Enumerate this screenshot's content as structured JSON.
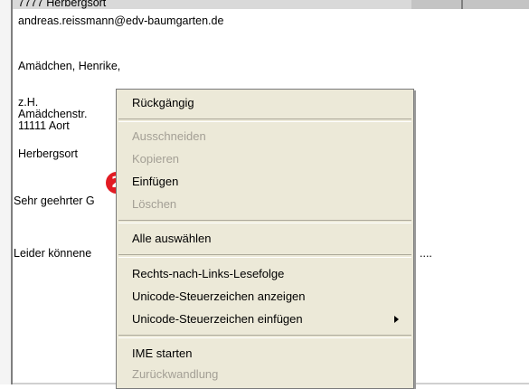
{
  "letter": {
    "line_postcode_city": "7777 Herbergsort",
    "line_email": "andreas.reissmann@edv-baumgarten.de",
    "line_name": "Amädchen, Henrike,",
    "line_attn": "z.H.",
    "line_street": "Amädchenstr.",
    "line_city": "11111 Aort",
    "line_place": "Herbergsort",
    "line_salutation": "Sehr geehrter G",
    "line_body": "Leider könnene",
    "line_ellipsis": "...."
  },
  "callout": {
    "number": "2"
  },
  "context_menu": {
    "items": [
      {
        "label": "Rückgängig",
        "enabled": true
      },
      {
        "label": "Ausschneiden",
        "enabled": false
      },
      {
        "label": "Kopieren",
        "enabled": false
      },
      {
        "label": "Einfügen",
        "enabled": true
      },
      {
        "label": "Löschen",
        "enabled": false
      },
      {
        "label": "Alle auswählen",
        "enabled": true
      },
      {
        "label": "Rechts-nach-Links-Lesefolge",
        "enabled": true
      },
      {
        "label": "Unicode-Steuerzeichen anzeigen",
        "enabled": true
      },
      {
        "label": "Unicode-Steuerzeichen einfügen",
        "enabled": true,
        "submenu": true
      },
      {
        "label": "IME starten",
        "enabled": true
      },
      {
        "label": "Zurückwandlung",
        "enabled": false
      }
    ]
  }
}
